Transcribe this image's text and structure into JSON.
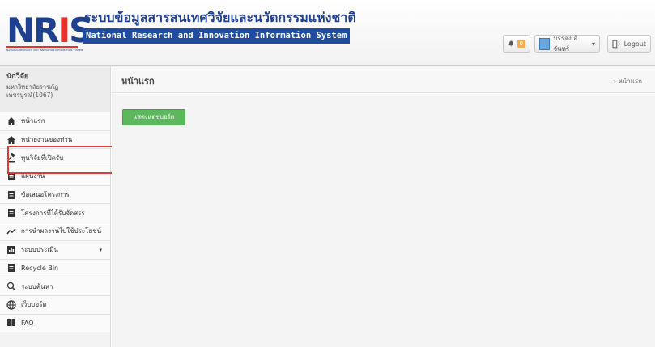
{
  "header": {
    "logo_text": "NRIS",
    "logo_subtext": "NATIONAL RESEARCH AND INNOVATION INFORMATION SYSTEM",
    "title_th": "ระบบข้อมูลสารสนเทศวิจัยและนวัตกรรมแห่งชาติ",
    "title_en": "National Research and Innovation Information System",
    "notification_count": "0",
    "user_name": "บรรจง สีจันทร์",
    "logout_label": "Logout"
  },
  "sidebar": {
    "role": "นักวิจัย",
    "org": "มหาวิทยาลัยราชภัฏเพชรบูรณ์(1067)",
    "items": [
      {
        "label": "หน้าแรก",
        "icon": "home-icon"
      },
      {
        "label": "หน่วยงานของท่าน",
        "icon": "home-icon"
      },
      {
        "label": "ทุนวิจัยที่เปิดรับ",
        "icon": "gavel-icon"
      },
      {
        "label": "แผนงาน",
        "icon": "file-icon"
      },
      {
        "label": "ข้อเสนอโครงการ",
        "icon": "file-icon"
      },
      {
        "label": "โครงการที่ได้รับจัดสรร",
        "icon": "file-icon"
      },
      {
        "label": "การนำผลงานไปใช้ประโยชน์",
        "icon": "trend-icon"
      },
      {
        "label": "ระบบประเมิน",
        "icon": "chart-icon"
      },
      {
        "label": "Recycle Bin",
        "icon": "file-icon"
      },
      {
        "label": "ระบบค้นหา",
        "icon": "search-icon"
      },
      {
        "label": "เว็บบอร์ด",
        "icon": "globe-icon"
      },
      {
        "label": "FAQ",
        "icon": "book-icon"
      }
    ]
  },
  "main": {
    "page_title": "หน้าแรก",
    "breadcrumb": "หน้าแรก",
    "green_button": "แสดงแดชบอร์ด"
  },
  "colors": {
    "brand_blue": "#1f4c9e",
    "brand_red": "#e8312b",
    "button_green": "#5cb85c",
    "highlight_red": "#e03a3a"
  }
}
